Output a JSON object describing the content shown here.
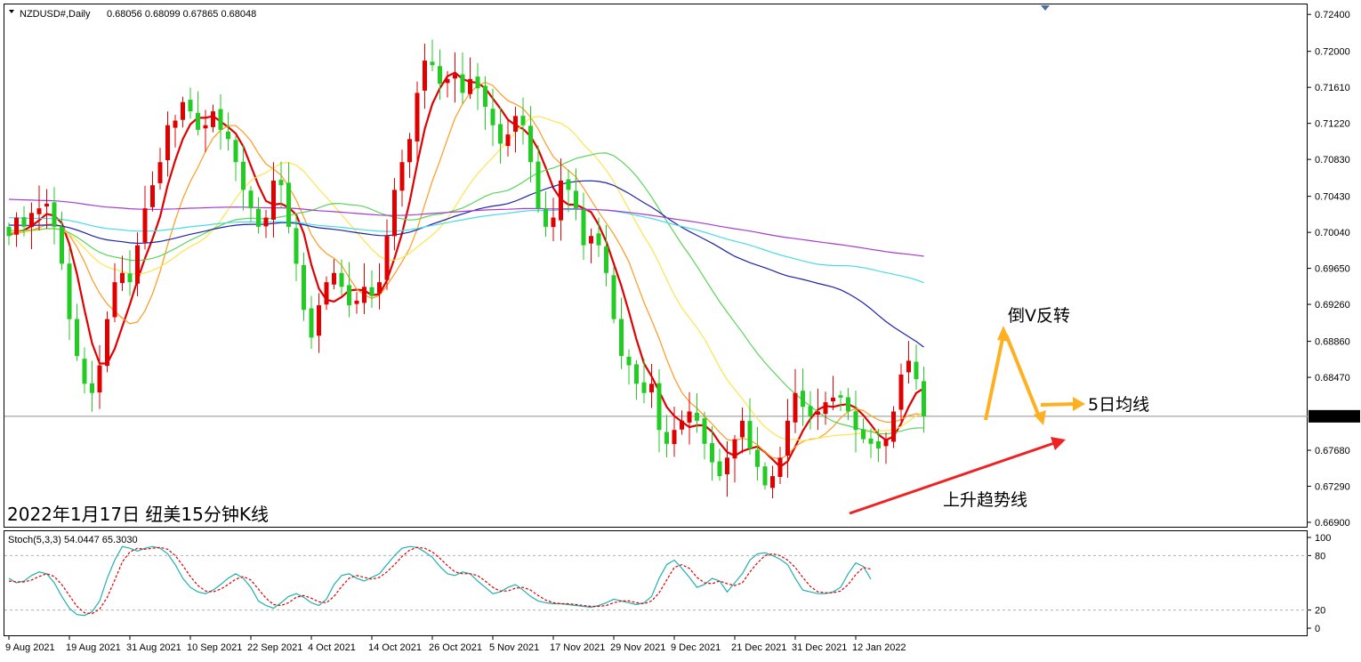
{
  "chart_data": {
    "type": "candlestick",
    "symbol_header": "NZDUSD#,Daily",
    "ohlc_header": "0.68056 0.68099 0.67865 0.68048",
    "caption": "2022年1月17日 纽美15分钟K线",
    "current_price_label": "0.68048",
    "y_ticks": [
      "0.72400",
      "0.72000",
      "0.71610",
      "0.71220",
      "0.70830",
      "0.70430",
      "0.70040",
      "0.69650",
      "0.69260",
      "0.68860",
      "0.68470",
      "0.68048",
      "0.67680",
      "0.67290",
      "0.66900"
    ],
    "ylim": [
      0.669,
      0.7245
    ],
    "x_labels": [
      {
        "label": "9 Aug 2021",
        "i": 0
      },
      {
        "label": "19 Aug 2021",
        "i": 8
      },
      {
        "label": "31 Aug 2021",
        "i": 16
      },
      {
        "label": "10 Sep 2021",
        "i": 24
      },
      {
        "label": "22 Sep 2021",
        "i": 32
      },
      {
        "label": "4 Oct 2021",
        "i": 40
      },
      {
        "label": "14 Oct 2021",
        "i": 48
      },
      {
        "label": "26 Oct 2021",
        "i": 56
      },
      {
        "label": "5 Nov 2021",
        "i": 64
      },
      {
        "label": "17 Nov 2021",
        "i": 72
      },
      {
        "label": "29 Nov 2021",
        "i": 80
      },
      {
        "label": "9 Dec 2021",
        "i": 88
      },
      {
        "label": "21 Dec 2021",
        "i": 96
      },
      {
        "label": "31 Dec 2021",
        "i": 104
      },
      {
        "label": "12 Jan 2022",
        "i": 112
      }
    ],
    "closes": [
      0.7,
      0.702,
      0.701,
      0.7025,
      0.703,
      0.7035,
      0.701,
      0.697,
      0.691,
      0.687,
      0.684,
      0.683,
      0.686,
      0.691,
      0.695,
      0.696,
      0.695,
      0.699,
      0.703,
      0.7055,
      0.708,
      0.712,
      0.7125,
      0.7145,
      0.7135,
      0.7115,
      0.712,
      0.7135,
      0.7115,
      0.7105,
      0.708,
      0.705,
      0.703,
      0.701,
      0.702,
      0.706,
      0.7055,
      0.701,
      0.697,
      0.692,
      0.689,
      0.6925,
      0.695,
      0.696,
      0.6945,
      0.6925,
      0.693,
      0.6945,
      0.6935,
      0.695,
      0.7,
      0.705,
      0.708,
      0.7105,
      0.7155,
      0.719,
      0.7185,
      0.7165,
      0.717,
      0.7175,
      0.7155,
      0.717,
      0.716,
      0.714,
      0.712,
      0.71,
      0.711,
      0.713,
      0.712,
      0.708,
      0.703,
      0.701,
      0.702,
      0.706,
      0.705,
      0.703,
      0.699,
      0.7,
      0.699,
      0.696,
      0.691,
      0.687,
      0.686,
      0.684,
      0.683,
      0.684,
      0.679,
      0.6775,
      0.679,
      0.68,
      0.681,
      0.68,
      0.6775,
      0.6755,
      0.674,
      0.676,
      0.678,
      0.68,
      0.677,
      0.675,
      0.673,
      0.674,
      0.676,
      0.68,
      0.683,
      0.6815,
      0.6805,
      0.681,
      0.682,
      0.6825,
      0.6825,
      0.681,
      0.679,
      0.678,
      0.6775,
      0.677,
      0.678,
      0.681,
      0.685,
      0.6865,
      0.6845,
      0.6805
    ],
    "moving_averages": [
      {
        "period": 5,
        "color": "#e00000"
      },
      {
        "period": 10,
        "color": "#ff9a1f"
      },
      {
        "period": 20,
        "color": "#ffe34d"
      },
      {
        "period": 30,
        "color": "#5bd45b"
      },
      {
        "period": 60,
        "color": "#1e22a8"
      },
      {
        "period": 100,
        "color": "#48dbe6"
      },
      {
        "period": 200,
        "color": "#a43ad0"
      }
    ],
    "colors": {
      "up": "#e00000",
      "down": "#22cc22",
      "grid": "#c8c8c8",
      "axis": "#000000",
      "arrow_orange": "#ffb020",
      "arrow_red": "#ee2222",
      "price_line": "#8f8f8f"
    },
    "annotations": {
      "inverted_v": "倒V反转",
      "ma5": "5日均线",
      "uptrend": "上升趋势线"
    },
    "stochastic": {
      "title": "Stoch(5,3,3) 54.0447 65.3030",
      "ticks": [
        "100",
        "80",
        "20",
        "0"
      ],
      "main_color": "#20b0b0",
      "signal_color": "#e00000",
      "main": [
        55,
        50,
        52,
        58,
        62,
        60,
        50,
        35,
        22,
        15,
        14,
        18,
        30,
        55,
        75,
        90,
        88,
        85,
        88,
        90,
        88,
        82,
        70,
        55,
        45,
        40,
        38,
        42,
        48,
        55,
        60,
        55,
        45,
        30,
        25,
        22,
        28,
        35,
        38,
        34,
        28,
        25,
        32,
        48,
        58,
        60,
        55,
        52,
        56,
        60,
        70,
        80,
        88,
        90,
        89,
        84,
        78,
        68,
        60,
        58,
        62,
        60,
        52,
        45,
        38,
        40,
        45,
        48,
        42,
        35,
        30,
        28,
        27,
        27,
        26,
        25,
        24,
        23,
        25,
        28,
        32,
        30,
        28,
        26,
        28,
        35,
        55,
        70,
        75,
        66,
        56,
        45,
        48,
        55,
        52,
        40,
        50,
        60,
        75,
        82,
        83,
        80,
        76,
        70,
        55,
        42,
        40,
        38,
        38,
        40,
        45,
        60,
        72,
        68,
        54
      ],
      "signal": [
        52,
        51,
        51,
        53,
        57,
        60,
        57,
        48,
        36,
        24,
        17,
        16,
        21,
        34,
        53,
        73,
        84,
        88,
        87,
        88,
        89,
        87,
        80,
        69,
        57,
        47,
        41,
        40,
        43,
        48,
        54,
        57,
        53,
        43,
        33,
        26,
        25,
        28,
        34,
        36,
        33,
        29,
        28,
        35,
        46,
        55,
        58,
        56,
        54,
        56,
        62,
        70,
        79,
        86,
        89,
        88,
        84,
        77,
        69,
        62,
        60,
        60,
        58,
        52,
        45,
        41,
        41,
        44,
        45,
        42,
        36,
        31,
        28,
        27,
        27,
        26,
        25,
        24,
        24,
        25,
        28,
        30,
        30,
        28,
        27,
        30,
        39,
        53,
        67,
        70,
        66,
        56,
        50,
        49,
        52,
        49,
        47,
        50,
        62,
        72,
        80,
        82,
        80,
        75,
        67,
        56,
        46,
        40,
        39,
        39,
        41,
        48,
        59,
        67,
        65
      ]
    }
  }
}
